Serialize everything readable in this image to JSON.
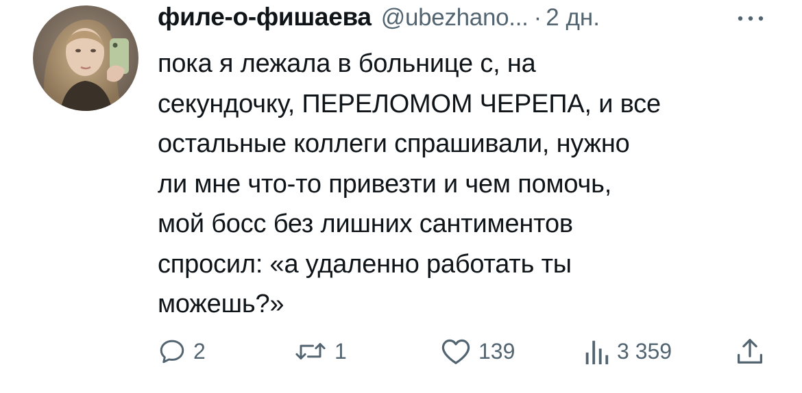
{
  "author": {
    "display_name": "филе-о-фишаева",
    "handle": "@ubezhano...",
    "separator": "·",
    "time_ago": "2 дн."
  },
  "tweet": {
    "text": "пока я лежала в больнице с, на\nсекундочку, ПЕРЕЛОМОМ ЧЕРЕПА, и все\nостальные коллеги спрашивали, нужно\nли мне что-то привезти и чем помочь,\nмой босс без лишних сантиментов\nспросил: «а удаленно работать ты\nможешь?»"
  },
  "actions": {
    "reply": {
      "icon": "reply-icon",
      "count": "2"
    },
    "retweet": {
      "icon": "retweet-icon",
      "count": "1"
    },
    "like": {
      "icon": "heart-icon",
      "count": "139"
    },
    "views": {
      "icon": "views-icon",
      "count": "3 359"
    },
    "share": {
      "icon": "share-icon"
    }
  },
  "colors": {
    "text_primary": "#0f1419",
    "text_secondary": "#536471",
    "background": "#ffffff"
  }
}
